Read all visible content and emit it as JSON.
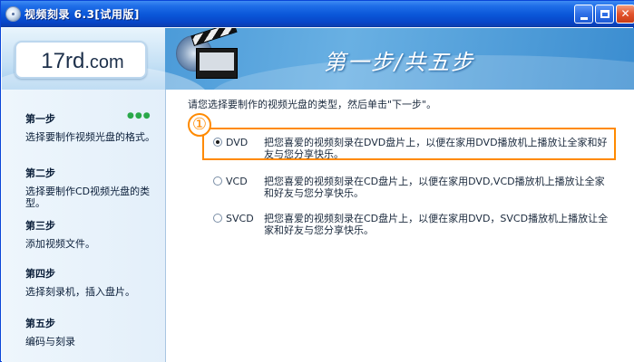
{
  "window": {
    "title": "视频刻录 6.3[试用版]"
  },
  "header": {
    "logo_text_main": "17rd",
    "logo_text_suffix": ".com",
    "step_title": "第一步/共五步"
  },
  "sidebar": {
    "steps": [
      {
        "title": "第一步",
        "desc": "选择要制作视频光盘的格式。",
        "active": true,
        "indicator": "●●●"
      },
      {
        "title": "第二步",
        "desc": "选择要制作CD视频光盘的类型。"
      },
      {
        "title": "第三步",
        "desc": "添加视频文件。"
      },
      {
        "title": "第四步",
        "desc": "选择刻录机，插入盘片。"
      },
      {
        "title": "第五步",
        "desc": "编码与刻录"
      }
    ]
  },
  "main": {
    "instruction": "请您选择要制作的视频光盘的类型，然后单击\"下一步\"。",
    "callout_number": "①",
    "options": [
      {
        "label": "DVD",
        "desc": "把您喜爱的视频刻录在DVD盘片上，以便在家用DVD播放机上播放让全家和好友与您分享快乐。",
        "checked": true
      },
      {
        "label": "VCD",
        "desc": "把您喜爱的视频刻录在CD盘片上，以便在家用DVD,VCD播放机上播放让全家和好友与您分享快乐。",
        "checked": false
      },
      {
        "label": "SVCD",
        "desc": "把您喜爱的视频刻录在CD盘片上，以便在家用DVD，SVCD播放机上播放让全家和好友与您分享快乐。",
        "checked": false
      }
    ]
  },
  "colors": {
    "titlebar": "#0a56d8",
    "highlight": "#ff8a00",
    "active_indicator": "#2aa84a"
  },
  "icons": [
    "app-disc-icon",
    "minimize-icon",
    "maximize-icon",
    "close-icon",
    "clapperboard-icon"
  ]
}
